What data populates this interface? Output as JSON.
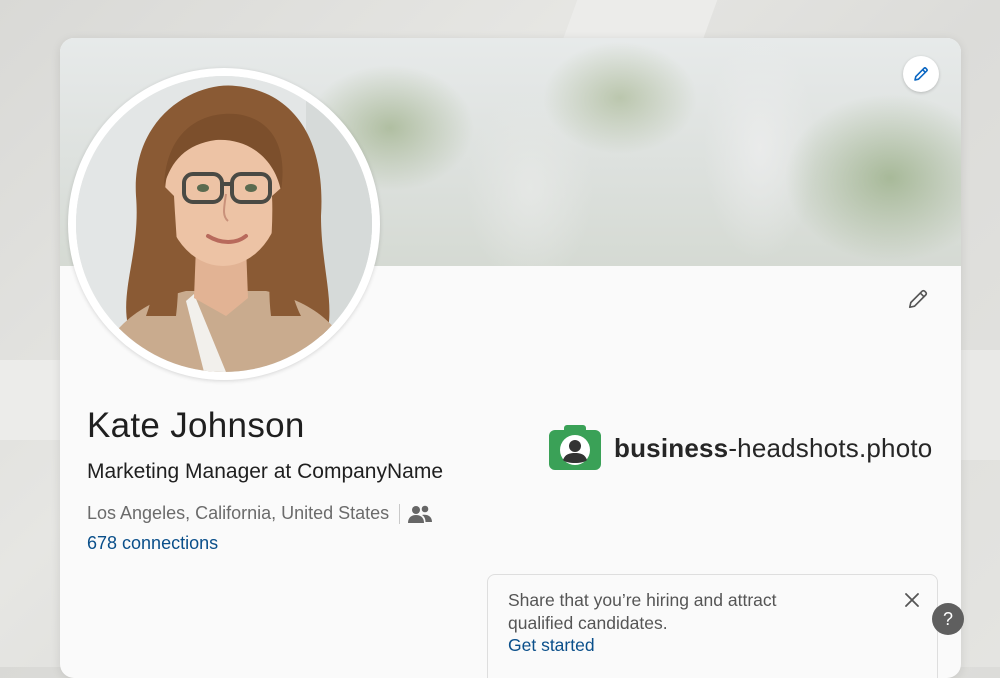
{
  "profile": {
    "name": "Kate Johnson",
    "headline": "Marketing Manager at CompanyName",
    "location": "Los Angeles, California, United States",
    "connections": "678 connections"
  },
  "brand": {
    "bold": "business",
    "rest": "-headshots.photo"
  },
  "hiring": {
    "text": "Share that you’re hiring and attract qualified candidates.",
    "link": "Get started"
  },
  "help": {
    "label": "?"
  },
  "icons": {
    "cover_edit": "pencil-icon",
    "intro_edit": "pencil-icon",
    "connections": "people-icon",
    "close": "close-icon",
    "brand_logo": "camera-person-icon"
  },
  "colors": {
    "link": "#0a4f8a",
    "brand_green": "#3aa157",
    "text": "#1f1f1f",
    "muted": "#6b6b6b"
  }
}
